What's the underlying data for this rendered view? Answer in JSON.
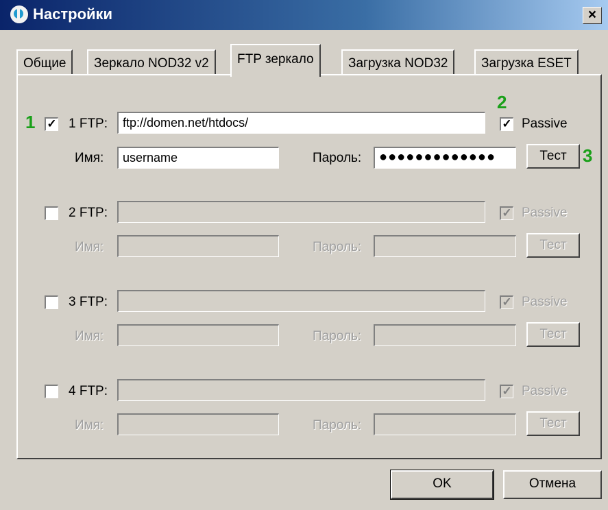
{
  "window": {
    "title": "Настройки",
    "close_glyph": "×"
  },
  "tabs": [
    {
      "label": "Общие",
      "active": false
    },
    {
      "label": "Зеркало NOD32 v2",
      "active": false
    },
    {
      "label": "FTP зеркало",
      "active": true
    },
    {
      "label": "Загрузка NOD32",
      "active": false
    },
    {
      "label": "Загрузка ESET",
      "active": false
    }
  ],
  "ftp_entries": [
    {
      "label": "1 FTP:",
      "enabled": true,
      "checked": true,
      "url": "ftp://domen.net/htdocs/",
      "passive_label": "Passive",
      "passive_checked": true,
      "user_label": "Имя:",
      "username": "username",
      "password_label": "Пароль:",
      "password": "●●●●●●●●●●●●●",
      "test_label": "Тест"
    },
    {
      "label": "2 FTP:",
      "enabled": false,
      "checked": false,
      "url": "",
      "passive_label": "Passive",
      "passive_checked": true,
      "user_label": "Имя:",
      "username": "",
      "password_label": "Пароль:",
      "password": "",
      "test_label": "Тест"
    },
    {
      "label": "3 FTP:",
      "enabled": false,
      "checked": false,
      "url": "",
      "passive_label": "Passive",
      "passive_checked": true,
      "user_label": "Имя:",
      "username": "",
      "password_label": "Пароль:",
      "password": "",
      "test_label": "Тест"
    },
    {
      "label": "4 FTP:",
      "enabled": false,
      "checked": false,
      "url": "",
      "passive_label": "Passive",
      "passive_checked": true,
      "user_label": "Имя:",
      "username": "",
      "password_label": "Пароль:",
      "password": "",
      "test_label": "Тест"
    }
  ],
  "annotations": {
    "a1": "1",
    "a2": "2",
    "a3": "3",
    "color": "#1aa01a"
  },
  "footer": {
    "ok_label": "OK",
    "cancel_label": "Отмена"
  },
  "colors": {
    "face": "#d4d0c8",
    "title_start": "#0a246a",
    "title_end": "#a6caf0"
  },
  "check_glyph": "✓"
}
